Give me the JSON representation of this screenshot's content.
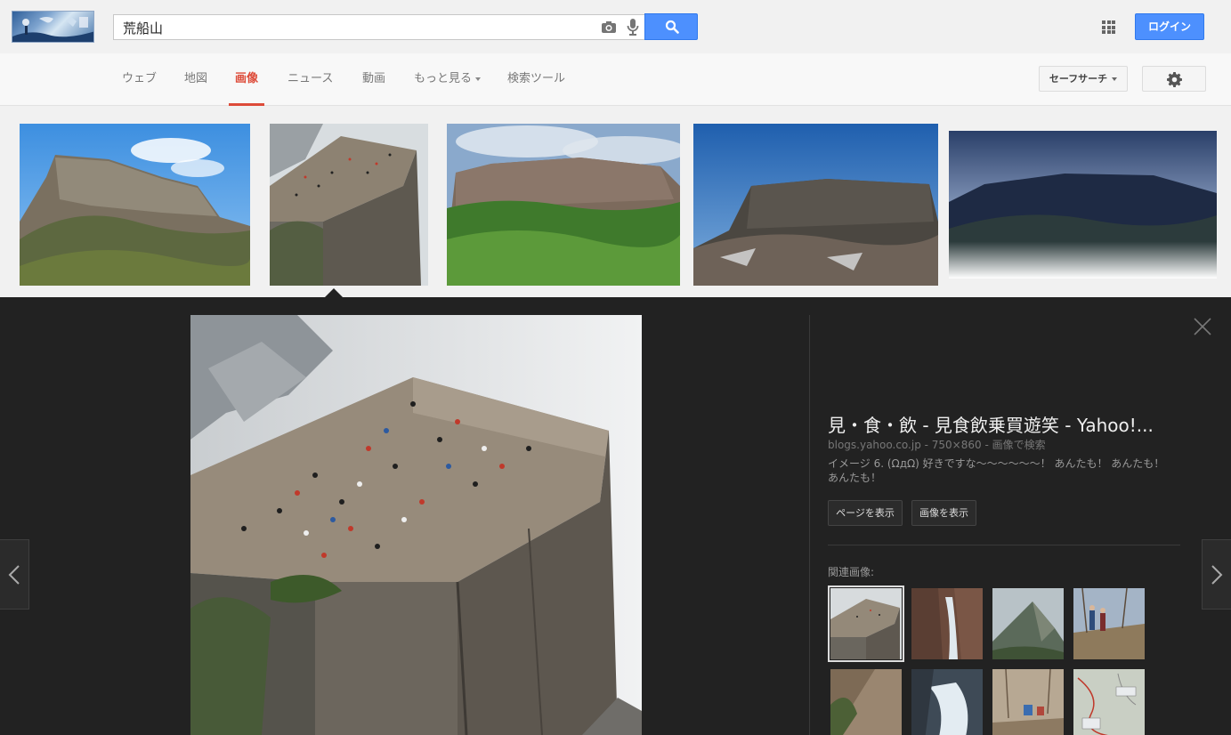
{
  "search": {
    "query": "荒船山"
  },
  "header": {
    "login_label": "ログイン"
  },
  "nav": {
    "tabs": [
      {
        "label": "ウェブ"
      },
      {
        "label": "地図"
      },
      {
        "label": "画像",
        "active": true
      },
      {
        "label": "ニュース"
      },
      {
        "label": "動画"
      },
      {
        "label": "もっと見る"
      },
      {
        "label": "検索ツール"
      }
    ],
    "safesearch_label": "セーフサーチ"
  },
  "results": {
    "thumbnails": [
      {
        "subject": "mesa-cliff-blue-sky"
      },
      {
        "subject": "cliff-plateau-with-people",
        "selected": true
      },
      {
        "subject": "mesa-cliff-green-forest"
      },
      {
        "subject": "mesa-cliff-winter"
      },
      {
        "subject": "mountain-ridge-dusk"
      }
    ]
  },
  "preview": {
    "title": "見・食・飲 - 見食飲乗買遊笑 - Yahoo!...",
    "meta": "blogs.yahoo.co.jp - 750×860 - 画像で検索",
    "description": "イメージ 6. (ΩдΩ) 好きですな〜〜〜〜〜〜！ あんたも！ あんたも！ あんたも！",
    "view_page_label": "ページを表示",
    "view_image_label": "画像を表示",
    "related_label": "関連画像:"
  },
  "colors": {
    "accent_blue": "#4d90fe",
    "active_tab_red": "#dd4b39",
    "panel_bg": "#222222"
  }
}
